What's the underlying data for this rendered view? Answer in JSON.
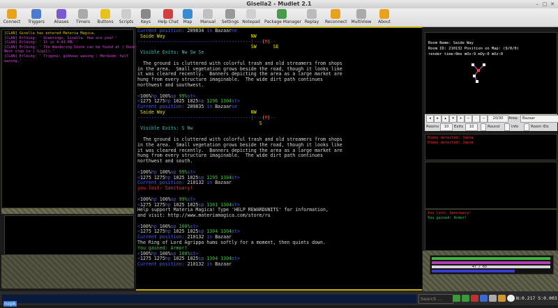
{
  "window": {
    "title": "Gisella2 - Mudlet 2.1"
  },
  "toolbar": [
    {
      "label": "Connect",
      "icon": "connect-icon",
      "color": "#e8a21c"
    },
    {
      "label": "Triggers",
      "icon": "triggers-icon",
      "color": "#4a7bd0"
    },
    {
      "label": "Aliases",
      "icon": "aliases-icon",
      "color": "#7a5ad0"
    },
    {
      "label": "Timers",
      "icon": "timers-icon",
      "color": "#aaaaaa"
    },
    {
      "label": "Buttons",
      "icon": "buttons-icon",
      "color": "#e8c21c"
    },
    {
      "label": "Scripts",
      "icon": "scripts-icon",
      "color": "#cccccc"
    },
    {
      "label": "Keys",
      "icon": "keys-icon",
      "color": "#888888"
    },
    {
      "label": "Help Chat",
      "icon": "help-chat-icon",
      "color": "#d04040"
    },
    {
      "label": "Map",
      "icon": "map-icon",
      "color": "#3a8ad0"
    },
    {
      "label": "Manual",
      "icon": "manual-icon",
      "color": "#c0c0c0"
    },
    {
      "label": "Settings",
      "icon": "settings-icon",
      "color": "#999999"
    },
    {
      "label": "Notepad",
      "icon": "notepad-icon",
      "color": "#d0d0d0"
    },
    {
      "label": "Package Manager",
      "icon": "package-manager-icon",
      "color": "#4a9a4a"
    },
    {
      "label": "Replay",
      "icon": "replay-icon",
      "color": "#bbbbbb"
    },
    {
      "label": "Reconnect",
      "icon": "reconnect-icon",
      "color": "#e8a21c"
    },
    {
      "label": "MultiView",
      "icon": "multiview-icon",
      "color": "#aaaaaa"
    },
    {
      "label": "About",
      "icon": "about-icon",
      "color": "#e8a21c"
    }
  ],
  "chat": [
    {
      "text": "[CLAN] Gisella has entered Materia Magica.",
      "color": "#e8c000"
    },
    {
      "text": "[CLAN] Erlking: ' Greetings, Gisella. How are you? '",
      "color": "#e040e0"
    },
    {
      "text": "[CLAN] Erlking: ' It is 4:43 PM. '",
      "color": "#e040e0"
    },
    {
      "text": "[CLAN] Erlking: ' The Wandering Stone can be found at ( Rune).",
      "color": "#e040e0"
    },
    {
      "text": "Next stop is ( Sigil).'",
      "color": "#e040e0"
    },
    {
      "text": "[CLAN] Erlking: ' Trigoni: gibbous waxing ; Merdulm: half",
      "color": "#e040e0"
    },
    {
      "text": "waxing.'",
      "color": "#e040e0"
    }
  ],
  "main_lines": [
    [
      {
        "t": "Current position: ",
        "c": "c-b"
      },
      {
        "t": "209834",
        "c": "c-w"
      },
      {
        "t": " in ",
        "c": "c-b"
      },
      {
        "t": "Bazaar",
        "c": "c-w"
      },
      {
        "t": "ne",
        "c": "c-b"
      }
    ],
    [
      {
        "t": " Saide Way                               ",
        "c": "c-y"
      },
      {
        "t": "NW",
        "c": "c-y"
      }
    ],
    [
      {
        "t": "-----------------------------------------|--",
        "c": "c-b"
      },
      {
        "t": "-",
        "c": "c-b"
      },
      {
        "t": "(",
        "c": "c-y"
      },
      {
        "t": "M",
        "c": "c-r"
      },
      {
        "t": ")",
        "c": "c-y"
      },
      {
        "t": "--",
        "c": "c-b"
      }
    ],
    [
      {
        "t": "                                         SW      SE",
        "c": "c-y"
      }
    ],
    [
      {
        "t": " Visible Exits: ",
        "c": "c-cy"
      },
      {
        "t": "Nw Sw Se",
        "c": "c-cy"
      }
    ],
    [
      {
        "t": "",
        "c": "c-w"
      }
    ],
    [
      {
        "t": "  The ground is cluttered with colorful trash and old streamers from shops",
        "c": "c-w"
      }
    ],
    [
      {
        "t": "in the area.  Small vegetation grows beside the road, though it looks like",
        "c": "c-w"
      }
    ],
    [
      {
        "t": "it was cleared recently.  Banners depicting the area as a large market are",
        "c": "c-w"
      }
    ],
    [
      {
        "t": "hung from every structure imaginable.  The wide dirt path continues",
        "c": "c-w"
      }
    ],
    [
      {
        "t": "northwest and southwest.",
        "c": "c-w"
      }
    ],
    [
      {
        "t": "",
        "c": "c-w"
      }
    ],
    [
      {
        "t": "<",
        "c": "c-b"
      },
      {
        "t": "100%",
        "c": "c-w"
      },
      {
        "t": "hp ",
        "c": "c-b"
      },
      {
        "t": "100%",
        "c": "c-w"
      },
      {
        "t": "sp ",
        "c": "c-b"
      },
      {
        "t": "99%",
        "c": "c-g"
      },
      {
        "t": "st>",
        "c": "c-b"
      }
    ],
    [
      {
        "t": "<",
        "c": "c-b"
      },
      {
        "t": "1275 1275",
        "c": "c-w"
      },
      {
        "t": "hp ",
        "c": "c-b"
      },
      {
        "t": "1025 1025",
        "c": "c-w"
      },
      {
        "t": "sp ",
        "c": "c-b"
      },
      {
        "t": "1296 1304",
        "c": "c-g"
      },
      {
        "t": "st>",
        "c": "c-b"
      }
    ],
    [
      {
        "t": "Current position: ",
        "c": "c-b"
      },
      {
        "t": "209835",
        "c": "c-w"
      },
      {
        "t": " in ",
        "c": "c-b"
      },
      {
        "t": "Bazaar",
        "c": "c-w"
      },
      {
        "t": "se",
        "c": "c-b"
      }
    ],
    [
      {
        "t": " Saide Way                               ",
        "c": "c-y"
      },
      {
        "t": "NW",
        "c": "c-y"
      }
    ],
    [
      {
        "t": "-----------------------------------------|--",
        "c": "c-b"
      },
      {
        "t": "-",
        "c": "c-b"
      },
      {
        "t": "(",
        "c": "c-y"
      },
      {
        "t": "M",
        "c": "c-r"
      },
      {
        "t": ")",
        "c": "c-y"
      },
      {
        "t": "--",
        "c": "c-b"
      }
    ],
    [
      {
        "t": "                                            S",
        "c": "c-y"
      }
    ],
    [
      {
        "t": " Visible Exits: ",
        "c": "c-cy"
      },
      {
        "t": "S Nw",
        "c": "c-cy"
      }
    ],
    [
      {
        "t": "",
        "c": "c-w"
      }
    ],
    [
      {
        "t": "  The ground is cluttered with colorful trash and old streamers from shops",
        "c": "c-w"
      }
    ],
    [
      {
        "t": "in the area.  Small vegetation grows beside the road, though it looks like",
        "c": "c-w"
      }
    ],
    [
      {
        "t": "it was cleared recently.  Banners depicting the area as a large market are",
        "c": "c-w"
      }
    ],
    [
      {
        "t": "hung from every structure imaginable.  The wide dirt path continues",
        "c": "c-w"
      }
    ],
    [
      {
        "t": "northwest and south.",
        "c": "c-w"
      }
    ],
    [
      {
        "t": "",
        "c": "c-w"
      }
    ],
    [
      {
        "t": "<",
        "c": "c-b"
      },
      {
        "t": "100%",
        "c": "c-w"
      },
      {
        "t": "hp ",
        "c": "c-b"
      },
      {
        "t": "100%",
        "c": "c-w"
      },
      {
        "t": "sp ",
        "c": "c-b"
      },
      {
        "t": "99%",
        "c": "c-g"
      },
      {
        "t": "st>",
        "c": "c-b"
      }
    ],
    [
      {
        "t": "<",
        "c": "c-b"
      },
      {
        "t": "1275 1275",
        "c": "c-w"
      },
      {
        "t": "hp ",
        "c": "c-b"
      },
      {
        "t": "1025 1025",
        "c": "c-w"
      },
      {
        "t": "sp ",
        "c": "c-b"
      },
      {
        "t": "1295 1304",
        "c": "c-g"
      },
      {
        "t": "st>",
        "c": "c-b"
      }
    ],
    [
      {
        "t": "Current position: ",
        "c": "c-b"
      },
      {
        "t": "210132",
        "c": "c-w"
      },
      {
        "t": " in ",
        "c": "c-b"
      },
      {
        "t": "Bazaar",
        "c": "c-w"
      }
    ],
    [
      {
        "t": "you lost: ",
        "c": "c-r"
      },
      {
        "t": "Sanctuary!",
        "c": "c-r"
      }
    ],
    [
      {
        "t": "",
        "c": "c-w"
      }
    ],
    [
      {
        "t": "<",
        "c": "c-b"
      },
      {
        "t": "100%",
        "c": "c-w"
      },
      {
        "t": "hp ",
        "c": "c-b"
      },
      {
        "t": "100%",
        "c": "c-w"
      },
      {
        "t": "sp ",
        "c": "c-b"
      },
      {
        "t": "99%",
        "c": "c-g"
      },
      {
        "t": "st>",
        "c": "c-b"
      }
    ],
    [
      {
        "t": "<",
        "c": "c-b"
      },
      {
        "t": "1275 1275",
        "c": "c-w"
      },
      {
        "t": "hp ",
        "c": "c-b"
      },
      {
        "t": "1025 1025",
        "c": "c-w"
      },
      {
        "t": "sp ",
        "c": "c-b"
      },
      {
        "t": "1301 1304",
        "c": "c-g"
      },
      {
        "t": "st>",
        "c": "c-b"
      }
    ],
    [
      {
        "t": "Help support Materia Magica! Type 'HELP REWARDUNITS' for information,",
        "c": "c-w"
      }
    ],
    [
      {
        "t": "and visit: http://www.materiamagica.com/store/ru",
        "c": "c-w"
      }
    ],
    [
      {
        "t": "",
        "c": "c-w"
      }
    ],
    [
      {
        "t": "<",
        "c": "c-b"
      },
      {
        "t": "100%",
        "c": "c-w"
      },
      {
        "t": "hp ",
        "c": "c-b"
      },
      {
        "t": "100%",
        "c": "c-w"
      },
      {
        "t": "sp ",
        "c": "c-b"
      },
      {
        "t": "100%",
        "c": "c-g"
      },
      {
        "t": "st>",
        "c": "c-b"
      }
    ],
    [
      {
        "t": "<",
        "c": "c-b"
      },
      {
        "t": "1275 1275",
        "c": "c-w"
      },
      {
        "t": "hp ",
        "c": "c-b"
      },
      {
        "t": "1025 1025",
        "c": "c-w"
      },
      {
        "t": "sp ",
        "c": "c-b"
      },
      {
        "t": "1304 1304",
        "c": "c-g"
      },
      {
        "t": "st>",
        "c": "c-b"
      }
    ],
    [
      {
        "t": "Current position: ",
        "c": "c-b"
      },
      {
        "t": "210132",
        "c": "c-w"
      },
      {
        "t": " in ",
        "c": "c-b"
      },
      {
        "t": "Bazaar",
        "c": "c-w"
      }
    ],
    [
      {
        "t": "The Ring of Lord Agrippa hums softly for a moment, then quiets down.",
        "c": "c-w"
      }
    ],
    [
      {
        "t": "You gained: ",
        "c": "c-g"
      },
      {
        "t": "Armor!",
        "c": "c-g"
      }
    ],
    [
      {
        "t": "<",
        "c": "c-b"
      },
      {
        "t": "100%",
        "c": "c-w"
      },
      {
        "t": "hp ",
        "c": "c-b"
      },
      {
        "t": "100%",
        "c": "c-w"
      },
      {
        "t": "sp ",
        "c": "c-b"
      },
      {
        "t": "100%",
        "c": "c-g"
      },
      {
        "t": "st>",
        "c": "c-b"
      }
    ],
    [
      {
        "t": "<",
        "c": "c-b"
      },
      {
        "t": "1275 1275",
        "c": "c-w"
      },
      {
        "t": "hp ",
        "c": "c-b"
      },
      {
        "t": "1025 1025",
        "c": "c-w"
      },
      {
        "t": "sp ",
        "c": "c-b"
      },
      {
        "t": "1304 1304",
        "c": "c-g"
      },
      {
        "t": "st>",
        "c": "c-b"
      }
    ],
    [
      {
        "t": "Current position: ",
        "c": "c-b"
      },
      {
        "t": "210132",
        "c": "c-w"
      },
      {
        "t": " in ",
        "c": "c-b"
      },
      {
        "t": "Bazaar",
        "c": "c-w"
      }
    ]
  ],
  "map": {
    "room_name": "Room Name: Saide Way",
    "room_id": "Room ID: 210132 Position on Map: (9/0/0)",
    "render": "render time:0ms mOx:9 mOy:0 mOz:0",
    "zoom": "20/30",
    "area_label": "Area:",
    "area": "Bazaar",
    "rooms_label": "Rooms",
    "rooms_value": "10",
    "exits_label": "Exits",
    "exits_value": "10",
    "round_label": "Round",
    "info_label": "Info",
    "room_ids_label": "Room IDs"
  },
  "enemies": [
    {
      "text": "Enemy detected: Jaina",
      "color": "#ff3030"
    },
    {
      "text": "Enemy detected: Jaina",
      "color": "#ff3030"
    }
  ],
  "affects": [
    {
      "text": "You lost: Sanctuary!",
      "color": "#ff3030"
    },
    {
      "text": "You gained: Armor!",
      "color": "#2fd12f"
    }
  ],
  "bars": {
    "hp_fraction": 1.0,
    "sp_fraction": 1.0,
    "st_fraction": 1.0,
    "exp_fraction": 0.7,
    "exp_text": "47 / 65",
    "hp_color": "#3cb43c",
    "sp_color": "#b43cb4",
    "st_color": "#d8d8d8",
    "exp_color": "#3a3ad0"
  },
  "command": {
    "text": "nopk"
  },
  "search": {
    "placeholder": "Search ..."
  },
  "status": {
    "coords": "N:0.217 S:0.003"
  }
}
